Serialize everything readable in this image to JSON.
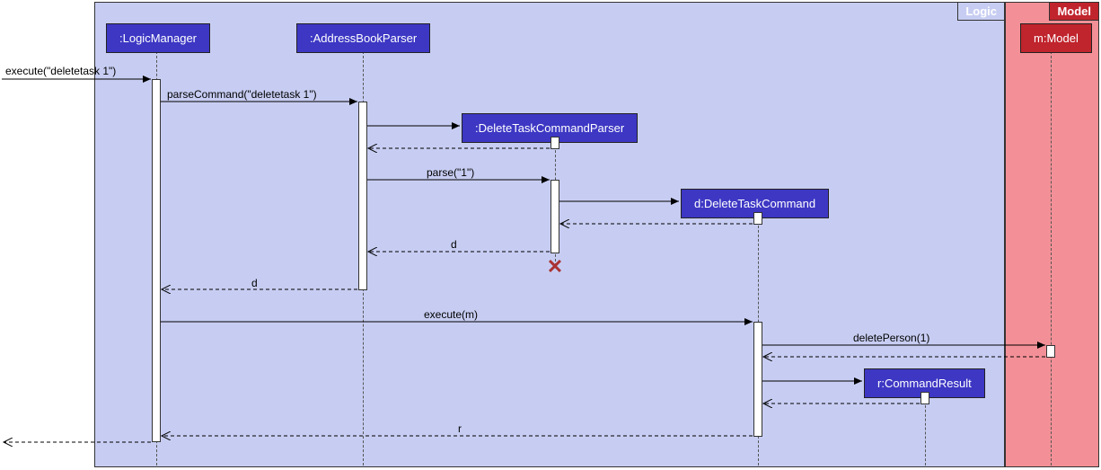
{
  "diagram_type": "sequence",
  "regions": {
    "logic": {
      "label": "Logic"
    },
    "model": {
      "label": "Model"
    }
  },
  "participants": {
    "logicManager": ":LogicManager",
    "addressBookParser": ":AddressBookParser",
    "deleteTaskCommandParser": ":DeleteTaskCommandParser",
    "deleteTaskCommand": "d:DeleteTaskCommand",
    "commandResult": "r:CommandResult",
    "model": "m:Model"
  },
  "messages": {
    "m1": "execute(\"deletetask 1\")",
    "m2": "parseCommand(\"deletetask 1\")",
    "m3": "parse(\"1\")",
    "m4": "d",
    "m5": "d",
    "m6": "execute(m)",
    "m7": "deletePerson(1)",
    "m8": "r"
  },
  "chart_data": {
    "type": "sequence_diagram",
    "frames": [
      {
        "name": "Logic",
        "participants": [
          ":LogicManager",
          ":AddressBookParser",
          ":DeleteTaskCommandParser",
          "d:DeleteTaskCommand",
          "r:CommandResult"
        ]
      },
      {
        "name": "Model",
        "participants": [
          "m:Model"
        ]
      }
    ],
    "events": [
      {
        "from": "external",
        "to": ":LogicManager",
        "label": "execute(\"deletetask 1\")",
        "type": "sync"
      },
      {
        "from": ":LogicManager",
        "to": ":AddressBookParser",
        "label": "parseCommand(\"deletetask 1\")",
        "type": "sync"
      },
      {
        "from": ":AddressBookParser",
        "to": ":DeleteTaskCommandParser",
        "label": "",
        "type": "create"
      },
      {
        "from": ":DeleteTaskCommandParser",
        "to": ":AddressBookParser",
        "label": "",
        "type": "return"
      },
      {
        "from": ":AddressBookParser",
        "to": ":DeleteTaskCommandParser",
        "label": "parse(\"1\")",
        "type": "sync"
      },
      {
        "from": ":DeleteTaskCommandParser",
        "to": "d:DeleteTaskCommand",
        "label": "",
        "type": "create"
      },
      {
        "from": "d:DeleteTaskCommand",
        "to": ":DeleteTaskCommandParser",
        "label": "",
        "type": "return"
      },
      {
        "from": ":DeleteTaskCommandParser",
        "to": ":AddressBookParser",
        "label": "d",
        "type": "return"
      },
      {
        "participant": ":DeleteTaskCommandParser",
        "type": "destroy"
      },
      {
        "from": ":AddressBookParser",
        "to": ":LogicManager",
        "label": "d",
        "type": "return"
      },
      {
        "from": ":LogicManager",
        "to": "d:DeleteTaskCommand",
        "label": "execute(m)",
        "type": "sync"
      },
      {
        "from": "d:DeleteTaskCommand",
        "to": "m:Model",
        "label": "deletePerson(1)",
        "type": "sync"
      },
      {
        "from": "m:Model",
        "to": "d:DeleteTaskCommand",
        "label": "",
        "type": "return"
      },
      {
        "from": "d:DeleteTaskCommand",
        "to": "r:CommandResult",
        "label": "",
        "type": "create"
      },
      {
        "from": "r:CommandResult",
        "to": "d:DeleteTaskCommand",
        "label": "",
        "type": "return"
      },
      {
        "from": "d:DeleteTaskCommand",
        "to": ":LogicManager",
        "label": "r",
        "type": "return"
      },
      {
        "from": ":LogicManager",
        "to": "external",
        "label": "",
        "type": "return"
      }
    ]
  }
}
